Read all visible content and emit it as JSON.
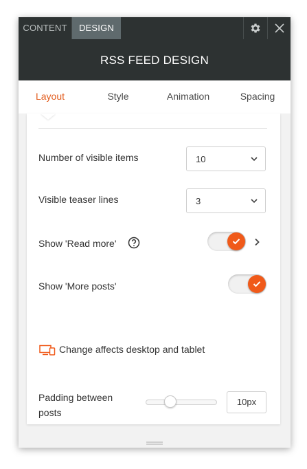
{
  "top_tabs": {
    "content": "CONTENT",
    "design": "DESIGN"
  },
  "header": {
    "title": "RSS FEED DESIGN"
  },
  "sub_tabs": [
    "Layout",
    "Style",
    "Animation",
    "Spacing"
  ],
  "settings": {
    "visible_items": {
      "label": "Number of visible items",
      "value": "10"
    },
    "teaser_lines": {
      "label": "Visible teaser lines",
      "value": "3"
    },
    "read_more": {
      "label": "Show 'Read more'",
      "enabled": true
    },
    "more_posts": {
      "label": "Show 'More posts'",
      "enabled": true
    },
    "device_note": "Change affects desktop and tablet",
    "padding": {
      "label": "Padding between posts",
      "value": "10px",
      "slider_fraction": 0.35
    }
  },
  "icons": [
    "gear-icon",
    "close-icon",
    "chevron-down-icon",
    "question-circle-icon",
    "chevron-right-icon",
    "checkmark-icon",
    "desktop-tablet-icon"
  ],
  "colors": {
    "accent": "#f05a1a",
    "active_tab_text": "#e25b1c",
    "topbar": "#2d3232",
    "design_tab": "#5f6a6d"
  }
}
